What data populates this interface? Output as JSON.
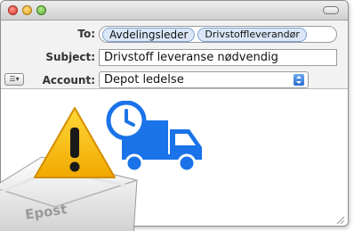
{
  "window": {
    "traffic_lights": [
      "close",
      "minimize",
      "zoom"
    ]
  },
  "headers": {
    "to_label": "To:",
    "to_recipients": [
      "Avdelingsleder",
      "Drivstoffleverandør"
    ],
    "subject_label": "Subject:",
    "subject_value": "Drivstoff leveranse nødvendig",
    "account_label": "Account:",
    "account_value": "Depot ledelse"
  },
  "overlay": {
    "envelope_text": "Epost",
    "icons": [
      "envelope-icon",
      "warning-icon",
      "delivery-truck-icon",
      "clock-icon"
    ]
  },
  "colors": {
    "warning_fill": "#f6c500",
    "truck_blue": "#1a73e8",
    "token_fill": "#dbe7f8"
  }
}
